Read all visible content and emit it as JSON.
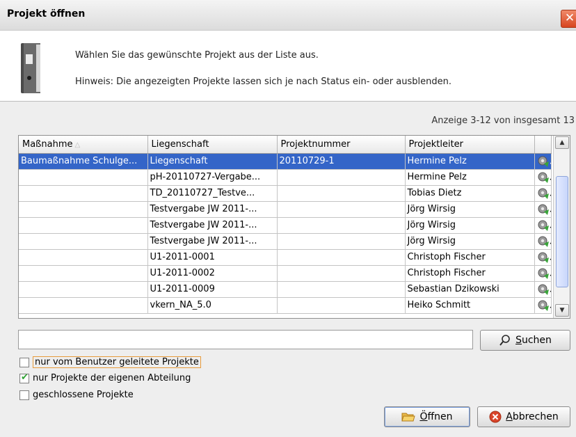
{
  "window": {
    "title": "Projekt öffnen",
    "close_glyph": "✕"
  },
  "header": {
    "line1": "Wählen Sie das gewünschte Projekt aus der Liste aus.",
    "line2": "Hinweis: Die angezeigten Projekte lassen sich je nach Status ein- oder ausblenden.",
    "icon": "binder-icon"
  },
  "counter": "Anzeige 3-12 von insgesamt 13",
  "table": {
    "columns": [
      "Maßnahme",
      "Liegenschaft",
      "Projektnummer",
      "Projektleiter"
    ],
    "sort_indicator": "△",
    "rows": [
      {
        "massnahme": "Baumaßnahme Schulge...",
        "liegenschaft": "Liegenschaft",
        "projektnummer": "20110729-1",
        "projektleiter": "Hermine Pelz",
        "selected": true
      },
      {
        "massnahme": "",
        "liegenschaft": "pH-20110727-Vergabe...",
        "projektnummer": "",
        "projektleiter": "Hermine Pelz"
      },
      {
        "massnahme": "",
        "liegenschaft": "TD_20110727_Testve...",
        "projektnummer": "",
        "projektleiter": "Tobias Dietz"
      },
      {
        "massnahme": "",
        "liegenschaft": "Testvergabe JW 2011-...",
        "projektnummer": "",
        "projektleiter": "Jörg Wirsig"
      },
      {
        "massnahme": "",
        "liegenschaft": "Testvergabe JW 2011-...",
        "projektnummer": "",
        "projektleiter": "Jörg Wirsig"
      },
      {
        "massnahme": "",
        "liegenschaft": "Testvergabe JW 2011-...",
        "projektnummer": "",
        "projektleiter": "Jörg Wirsig"
      },
      {
        "massnahme": "",
        "liegenschaft": "U1-2011-0001",
        "projektnummer": "",
        "projektleiter": "Christoph Fischer"
      },
      {
        "massnahme": "",
        "liegenschaft": "U1-2011-0002",
        "projektnummer": "",
        "projektleiter": "Christoph Fischer"
      },
      {
        "massnahme": "",
        "liegenschaft": "U1-2011-0009",
        "projektnummer": "",
        "projektleiter": "Sebastian Dzikowski"
      },
      {
        "massnahme": "",
        "liegenschaft": "vkern_NA_5.0",
        "projektnummer": "",
        "projektleiter": "Heiko Schmitt"
      }
    ],
    "row_icon": "gear-icon"
  },
  "search": {
    "value": "",
    "button_label": "Suchen",
    "button_hotkey": "S",
    "button_rest": "uchen"
  },
  "filters": [
    {
      "label": "nur vom Benutzer geleitete Projekte",
      "checked": false,
      "focused": true
    },
    {
      "label": "nur Projekte der eigenen Abteilung",
      "checked": true
    },
    {
      "label": "geschlossene Projekte",
      "checked": false
    }
  ],
  "buttons": {
    "open": {
      "hotkey": "Ö",
      "rest": "ffnen"
    },
    "cancel": {
      "hotkey": "A",
      "rest": "bbrechen"
    }
  },
  "colors": {
    "selection": "#3465c8",
    "close": "#d8451f",
    "check": "#2ea232"
  }
}
